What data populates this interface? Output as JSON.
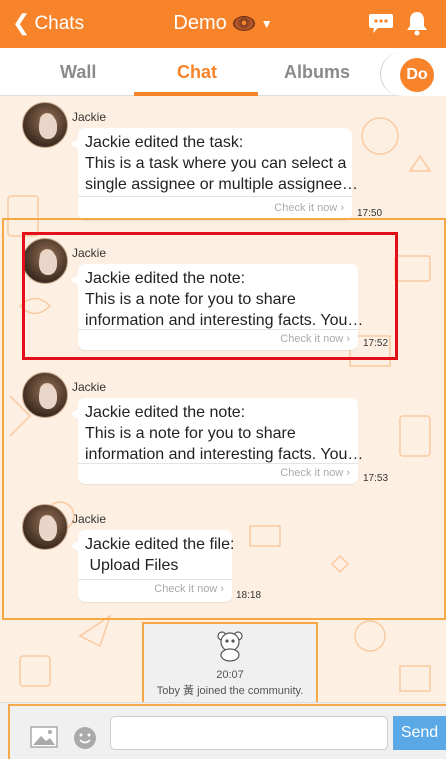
{
  "header": {
    "back_label": "Chats",
    "title": "Demo",
    "colors": {
      "brand": "#f7842a"
    }
  },
  "tabs": [
    {
      "label": "Wall"
    },
    {
      "label": "Chat"
    },
    {
      "label": "Albums"
    }
  ],
  "profile_badge": "Do",
  "messages": [
    {
      "sender": "Jackie",
      "text": "Jackie edited the task:\nThis is a task where you can select a\nsingle assignee or multiple assignee…",
      "action": "Check it now",
      "time": "17:50"
    },
    {
      "sender": "Jackie",
      "text": "Jackie edited the note:\nThis is a note for you to share\ninformation and interesting facts. You…",
      "action": "Check it now",
      "time": "17:52"
    },
    {
      "sender": "Jackie",
      "text": "Jackie edited the note:\nThis is a note for you to share\ninformation and interesting facts. You…",
      "action": "Check it now",
      "time": "17:53"
    },
    {
      "sender": "Jackie",
      "text": "Jackie edited the file:\n Upload Files",
      "action": "Check it now",
      "time": "18:18"
    }
  ],
  "notice": {
    "time": "20:07",
    "text": "Toby 黃 joined the community."
  },
  "composer": {
    "value": "",
    "placeholder": "",
    "send_label": "Send"
  },
  "icons": {
    "back": "chevron-left-icon",
    "chat": "chat-bubble-icon",
    "bell": "bell-icon",
    "image": "image-icon",
    "emoji": "emoji-icon"
  }
}
